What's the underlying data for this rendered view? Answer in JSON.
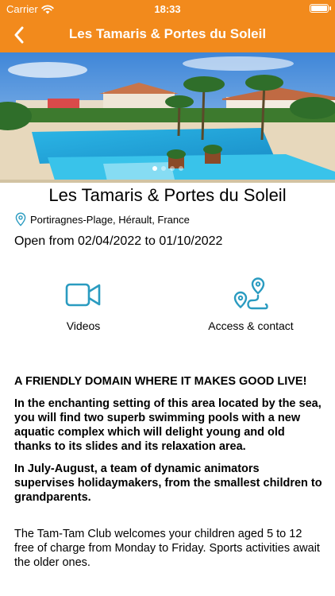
{
  "status_bar": {
    "carrier": "Carrier",
    "time": "18:33"
  },
  "nav": {
    "title": "Les Tamaris & Portes du Soleil",
    "back_icon": "chevron-left-icon"
  },
  "gallery": {
    "slide_count": 4,
    "active_slide": 1
  },
  "place": {
    "name": "Les Tamaris & Portes du Soleil",
    "location": "Portiragnes-Plage, Hérault, France",
    "dates": "Open from 02/04/2022 to 01/10/2022"
  },
  "actions": {
    "videos": {
      "label": "Videos",
      "icon": "video-camera-icon"
    },
    "access": {
      "label": "Access & contact",
      "icon": "route-icon"
    }
  },
  "description": {
    "headline": "A FRIENDLY DOMAIN WHERE IT MAKES GOOD LIVE!",
    "paragraph1": "In the enchanting setting of this area located by the sea, you will find two superb swimming pools with a new aquatic complex which will delight young and old thanks to its slides and its relaxation area.",
    "paragraph2": "In July-August, a team of dynamic animators supervises holidaymakers, from the smallest children to grandparents.",
    "paragraph3": "The Tam-Tam Club welcomes your children aged 5 to 12 free of charge from Monday to Friday. Sports activities await the older ones."
  },
  "colors": {
    "accent": "#f28a1c",
    "icon": "#2a9bc0"
  }
}
